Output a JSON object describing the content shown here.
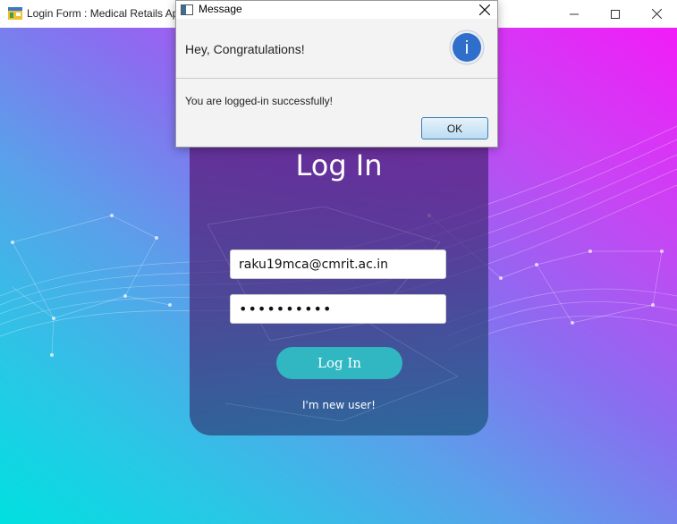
{
  "window": {
    "title": "Login Form : Medical Retails Ap",
    "controls": [
      "minimize-icon",
      "maximize-icon",
      "close-icon"
    ]
  },
  "login": {
    "heading": "Log In",
    "email_value": "raku19mca@cmrit.ac.in",
    "password_value": "••••••••••",
    "login_button": "Log In",
    "new_user_link": "I'm new user!"
  },
  "dialog": {
    "title": "Message",
    "header": "Hey, Congratulations!",
    "message": "You are logged-in successfully!",
    "ok_button": "OK",
    "icon": "info-icon",
    "icon_glyph": "i"
  },
  "colors": {
    "gradient_start": "#00e0e0",
    "gradient_end": "#f21cf8",
    "button_teal": "#30b7c2",
    "info_blue": "#2f6fcb"
  }
}
